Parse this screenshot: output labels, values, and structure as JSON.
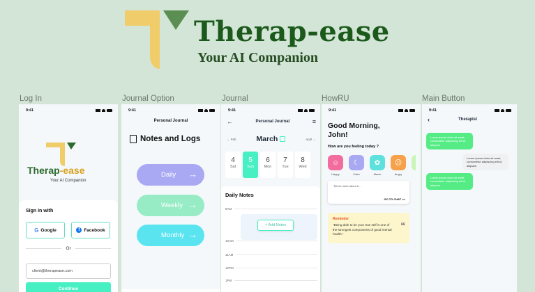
{
  "header": {
    "brand_title": "Therap-ease",
    "brand_subtitle": "Your AI Companion"
  },
  "colors": {
    "background": "#d3e5d6",
    "brand_green": "#1c5a1c",
    "brand_yellow": "#f0cd6a",
    "accent_mint": "#46f0c2",
    "lavender": "#a9a8f3",
    "cyan": "#5ae4f0"
  },
  "frames": [
    {
      "label": "Log In"
    },
    {
      "label": "Journal Option"
    },
    {
      "label": "Journal"
    },
    {
      "label": "HowRU"
    },
    {
      "label": "Main Button"
    }
  ],
  "status_time": "9:41",
  "login": {
    "brand": "Therap-ease",
    "brand_a": "Therap",
    "brand_b": "-ease",
    "subtitle": "Your AI Companion",
    "signin_title": "Sign in with",
    "google_label": "Google",
    "facebook_label": "Facebook",
    "or_label": "Or",
    "email_value": "client@therapease.com",
    "continue_label": "Continue"
  },
  "journal_option": {
    "title": "Personal Journal",
    "heading": "Notes and Logs",
    "options": [
      {
        "label": "Daily",
        "color": "#a9a8f3"
      },
      {
        "label": "Weekly",
        "color": "#97ecc5"
      },
      {
        "label": "Monthly",
        "color": "#5ae4f0"
      }
    ]
  },
  "journal": {
    "title": "Personal Journal",
    "prev": "Feb",
    "next": "April",
    "month": "March",
    "days": [
      {
        "num": "4",
        "wd": "Sat"
      },
      {
        "num": "5",
        "wd": "Sun",
        "selected": true
      },
      {
        "num": "6",
        "wd": "Mon"
      },
      {
        "num": "7",
        "wd": "Tue"
      },
      {
        "num": "8",
        "wd": "Wed"
      }
    ],
    "notes_title": "Daily Notes",
    "hours": [
      "9AM",
      "10AM",
      "11AM",
      "12PM",
      "1PM"
    ],
    "add_notes_label": "+ Add Notes"
  },
  "howru": {
    "greeting_line1": "Good Morning,",
    "greeting_line2": "John!",
    "question": "How are you feeling today ?",
    "moods": [
      {
        "label": "Happy",
        "color": "#f26d9e",
        "icon": "smile-icon",
        "glyph": "☺"
      },
      {
        "label": "Calm",
        "color": "#a9a8f3",
        "icon": "moon-icon",
        "glyph": "☾"
      },
      {
        "label": "Manic",
        "color": "#5ee1dc",
        "icon": "flower-icon",
        "glyph": "✿"
      },
      {
        "label": "Angry",
        "color": "#f7a14a",
        "icon": "angry-icon",
        "glyph": "☹"
      },
      {
        "label": "",
        "color": "#c9f5b8",
        "icon": "more-mood-icon",
        "glyph": ""
      }
    ],
    "tell_placeholder": "Tell us more about it...",
    "go_to_chat": "GO TO CHAT >>",
    "reminder_title": "Reminder",
    "reminder_quote": "\"Being able to be your true self is one of the strongest components of good mental health.\""
  },
  "chat": {
    "title": "Therapist",
    "messages": [
      {
        "from": "ai",
        "text": "Lorem ipsum dolor sit amet, consectetur adipiscing elit ut aliquam"
      },
      {
        "from": "me",
        "text": "Lorem ipsum dolor sit amet, consectetur adipiscing elit ut aliquam"
      },
      {
        "from": "ai",
        "text": "Lorem ipsum dolor sit amet, consectetur adipiscing elit ut aliquam"
      }
    ]
  }
}
